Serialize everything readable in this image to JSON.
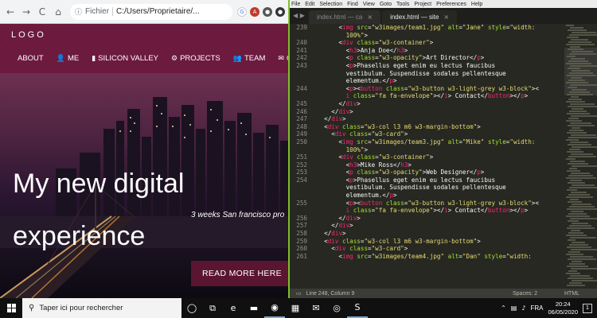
{
  "browser": {
    "address_proto": "Fichier",
    "address_path": "C:/Users/Proprietaire/...",
    "nav": {
      "back": "←",
      "forward": "→",
      "reload": "C",
      "home": "⌂"
    },
    "extensions": [
      {
        "name": "ext-1",
        "glyph": "G",
        "color": "#ffffff"
      },
      {
        "name": "ext-2",
        "glyph": "ABP",
        "color": "#c0392b"
      },
      {
        "name": "ext-3",
        "glyph": "●",
        "color": "#555555"
      },
      {
        "name": "ext-4",
        "glyph": "●",
        "color": "#333333"
      }
    ]
  },
  "site": {
    "logo": "LOGO",
    "nav": [
      {
        "label": "ABOUT",
        "icon": ""
      },
      {
        "label": "ME",
        "icon": "👤"
      },
      {
        "label": "SILICON VALLEY",
        "icon": "▮"
      },
      {
        "label": "PROJECTS",
        "icon": "⚙"
      },
      {
        "label": "TEAM",
        "icon": "👥"
      },
      {
        "label": "C",
        "icon": "✉"
      }
    ],
    "hero": {
      "title_line1": "My new digital",
      "title_line2": "experience",
      "subtitle": "3 weeks San francisco pro",
      "button": "READ MORE HERE",
      "mini_icons": "🖵 ◁"
    }
  },
  "editor": {
    "menu": [
      "File",
      "Edit",
      "Selection",
      "Find",
      "View",
      "Goto",
      "Tools",
      "Project",
      "Preferences",
      "Help"
    ],
    "tabs": [
      {
        "label": "index.html — ca",
        "active": false
      },
      {
        "label": "index.html — site",
        "active": true
      }
    ],
    "lines": [
      {
        "n": "239",
        "html": "      <span class='p'>&lt;</span><span class='t'>img</span> <span class='a'>src</span>=<span class='s'>\"w3images/team1.jpg\"</span> <span class='a'>alt</span>=<span class='s'>\"Jane\"</span> <span class='a'>style</span>=<span class='s'>\"width:</span>"
      },
      {
        "n": "",
        "html": "        <span class='s'>100%\"</span>&gt;"
      },
      {
        "n": "240",
        "html": "      &lt;<span class='t'>div</span> <span class='a'>class</span>=<span class='s'>\"w3-container\"</span>&gt;"
      },
      {
        "n": "241",
        "html": "        &lt;<span class='t'>h3</span>&gt;Anja Doe&lt;/<span class='t'>h3</span>&gt;"
      },
      {
        "n": "242",
        "html": "        &lt;<span class='t'>p</span> <span class='a'>class</span>=<span class='s'>\"w3-opacity\"</span>&gt;Art Director&lt;/<span class='t'>p</span>&gt;"
      },
      {
        "n": "243",
        "html": "        &lt;<span class='t'>p</span>&gt;Phasellus eget enim eu lectus faucibus"
      },
      {
        "n": "",
        "html": "        vestibulum. Suspendisse sodales pellentesque"
      },
      {
        "n": "",
        "html": "        elementum.&lt;/<span class='t'>p</span>&gt;"
      },
      {
        "n": "244",
        "html": "        &lt;<span class='t'>p</span>&gt;&lt;<span class='t'>button</span> <span class='a'>class</span>=<span class='s'>\"w3-button w3-light-grey w3-block\"</span>&gt;&lt;"
      },
      {
        "n": "",
        "html": "        <span class='t'>i</span> <span class='a'>class</span>=<span class='s'>\"fa fa-envelope\"</span>&gt;&lt;/<span class='t'>i</span>&gt; Contact&lt;/<span class='t'>button</span>&gt;&lt;/<span class='t'>p</span>&gt;"
      },
      {
        "n": "245",
        "html": "      &lt;/<span class='t'>div</span>&gt;"
      },
      {
        "n": "246",
        "html": "    &lt;/<span class='t'>div</span>&gt;"
      },
      {
        "n": "247",
        "html": "  &lt;/<span class='t'>div</span>&gt;"
      },
      {
        "n": "248",
        "html": "  &lt;<span class='t'>div</span> <span class='a'>class</span>=<span class='s'>\"w3-col l3 m6 w3-margin-bottom\"</span>&gt;"
      },
      {
        "n": "249",
        "html": "    &lt;<span class='t'>div</span> <span class='a'>class</span>=<span class='s'>\"w3-card\"</span>&gt;"
      },
      {
        "n": "250",
        "html": "      &lt;<span class='t'>img</span> <span class='a'>src</span>=<span class='s'>\"w3images/team3.jpg\"</span> <span class='a'>alt</span>=<span class='s'>\"Mike\"</span> <span class='a'>style</span>=<span class='s'>\"width:</span>"
      },
      {
        "n": "",
        "html": "        <span class='s'>100%\"</span>&gt;"
      },
      {
        "n": "251",
        "html": "      &lt;<span class='t'>div</span> <span class='a'>class</span>=<span class='s'>\"w3-container\"</span>&gt;"
      },
      {
        "n": "252",
        "html": "        &lt;<span class='t'>h3</span>&gt;Mike Ross&lt;/<span class='t'>h3</span>&gt;"
      },
      {
        "n": "253",
        "html": "        &lt;<span class='t'>p</span> <span class='a'>class</span>=<span class='s'>\"w3-opacity\"</span>&gt;Web Designer&lt;/<span class='t'>p</span>&gt;"
      },
      {
        "n": "254",
        "html": "        &lt;<span class='t'>p</span>&gt;Phasellus eget enim eu lectus faucibus"
      },
      {
        "n": "",
        "html": "        vestibulum. Suspendisse sodales pellentesque"
      },
      {
        "n": "",
        "html": "        elementum.&lt;/<span class='t'>p</span>&gt;"
      },
      {
        "n": "255",
        "html": "        &lt;<span class='t'>p</span>&gt;&lt;<span class='t'>button</span> <span class='a'>class</span>=<span class='s'>\"w3-button w3-light-grey w3-block\"</span>&gt;&lt;"
      },
      {
        "n": "",
        "html": "        <span class='t'>i</span> <span class='a'>class</span>=<span class='s'>\"fa fa-envelope\"</span>&gt;&lt;/<span class='t'>i</span>&gt; Contact&lt;/<span class='t'>button</span>&gt;&lt;/<span class='t'>p</span>&gt;"
      },
      {
        "n": "256",
        "html": "      &lt;/<span class='t'>div</span>&gt;"
      },
      {
        "n": "257",
        "html": "    &lt;/<span class='t'>div</span>&gt;"
      },
      {
        "n": "258",
        "html": "  &lt;/<span class='t'>div</span>&gt;"
      },
      {
        "n": "259",
        "html": "  &lt;<span class='t'>div</span> <span class='a'>class</span>=<span class='s'>\"w3-col l3 m6 w3-margin-bottom\"</span>&gt;"
      },
      {
        "n": "260",
        "html": "    &lt;<span class='t'>div</span> <span class='a'>class</span>=<span class='s'>\"w3-card\"</span>&gt;"
      },
      {
        "n": "261",
        "html": "      &lt;<span class='t'>img</span> <span class='a'>src</span>=<span class='s'>\"w3images/team4.jpg\"</span> <span class='a'>alt</span>=<span class='s'>\"Dan\"</span> <span class='a'>style</span>=<span class='s'>\"width:</span>"
      }
    ],
    "status": {
      "position": "Line 248, Column 9",
      "spaces": "Spaces: 2",
      "syntax": "HTML"
    }
  },
  "taskbar": {
    "search_placeholder": "Taper ici pour rechercher",
    "apps": [
      {
        "name": "task-view-icon",
        "glyph": "◯",
        "active": false
      },
      {
        "name": "multitask-icon",
        "glyph": "⧉",
        "active": false
      },
      {
        "name": "edge-icon",
        "glyph": "e",
        "active": false
      },
      {
        "name": "explorer-icon",
        "glyph": "▬",
        "active": false
      },
      {
        "name": "chrome-icon",
        "glyph": "◉",
        "active": true
      },
      {
        "name": "store-icon",
        "glyph": "▦",
        "active": false
      },
      {
        "name": "mail-icon",
        "glyph": "✉",
        "active": false
      },
      {
        "name": "globe-icon",
        "glyph": "◎",
        "active": false
      },
      {
        "name": "sublime-icon",
        "glyph": "S",
        "active": true
      }
    ],
    "tray": {
      "language": "FRA",
      "time": "20:24",
      "date": "06/05/2020",
      "notifications": "1"
    }
  }
}
